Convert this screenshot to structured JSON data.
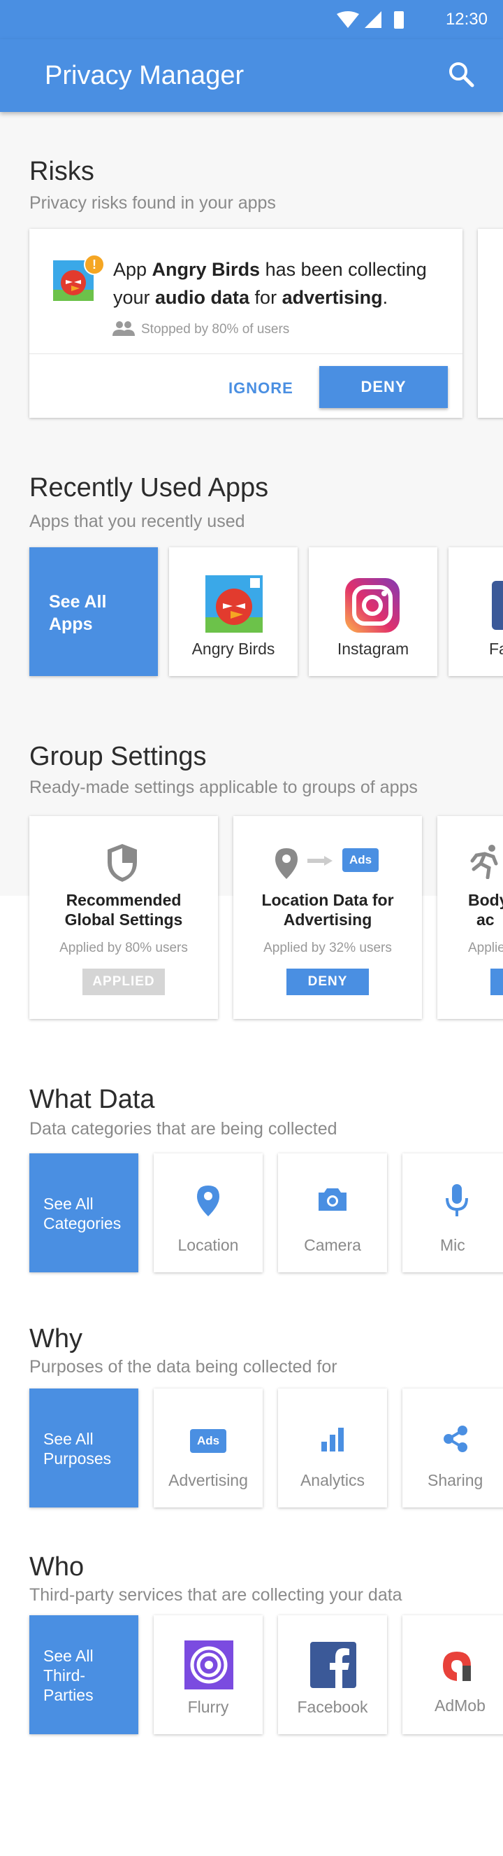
{
  "status_bar": {
    "time": "12:30"
  },
  "app_bar": {
    "title": "Privacy Manager"
  },
  "risks": {
    "title": "Risks",
    "subtitle": "Privacy risks found in your apps",
    "card": {
      "prefix": "App ",
      "app_name": "Angry Birds",
      "middle1": " has been collecting",
      "line2_prefix": "your ",
      "data_type": "audio data",
      "middle2": " for ",
      "purpose": "advertising",
      "suffix": ".",
      "stopped_text": "Stopped by 80% of users",
      "ignore_label": "IGNORE",
      "deny_label": "DENY",
      "warning_badge": "!"
    }
  },
  "recent_apps": {
    "title": "Recently Used Apps",
    "subtitle": "Apps that you recently used",
    "see_all": "See All Apps",
    "see_all_line1": "See All",
    "see_all_line2": "Apps",
    "apps": [
      {
        "label": "Angry Birds",
        "icon": "angry-birds-icon"
      },
      {
        "label": "Instagram",
        "icon": "instagram-icon"
      },
      {
        "label": "Fac",
        "icon": "facebook-icon"
      }
    ]
  },
  "group_settings": {
    "title": "Group Settings",
    "subtitle": "Ready-made settings applicable to groups of apps",
    "cards": [
      {
        "title_line1": "Recommended",
        "title_line2": "Global Settings",
        "applied": "Applied by 80% users",
        "button": "APPLIED",
        "icon": "shield-icon"
      },
      {
        "title_line1": "Location Data for",
        "title_line2": "Advertising",
        "applied": "Applied by 32% users",
        "button": "DENY",
        "icon": "location-to-ads-icon",
        "ads_badge": "Ads"
      },
      {
        "title_line1": "Body",
        "title_line2": "ac",
        "applied": "Applie",
        "button": "",
        "icon": "running-icon"
      }
    ]
  },
  "what_data": {
    "title": "What Data",
    "subtitle": "Data categories that are being collected",
    "see_all_line1": "See All",
    "see_all_line2": "Categories",
    "items": [
      {
        "label": "Location",
        "icon": "location-pin-icon"
      },
      {
        "label": "Camera",
        "icon": "camera-icon"
      },
      {
        "label": "Mic",
        "icon": "microphone-icon"
      }
    ]
  },
  "why": {
    "title": "Why",
    "subtitle": "Purposes of the data being collected for",
    "see_all_line1": "See All",
    "see_all_line2": "Purposes",
    "items": [
      {
        "label": "Advertising",
        "icon": "ads-icon",
        "badge": "Ads"
      },
      {
        "label": "Analytics",
        "icon": "bar-chart-icon"
      },
      {
        "label": "Sharing",
        "icon": "share-icon"
      }
    ]
  },
  "who": {
    "title": "Who",
    "subtitle": "Third-party services that are collecting your data",
    "see_all_line1": "See All",
    "see_all_line2": "Third-",
    "see_all_line3": "Parties",
    "items": [
      {
        "label": "Flurry",
        "icon": "flurry-icon"
      },
      {
        "label": "Facebook",
        "icon": "facebook-logo-icon"
      },
      {
        "label": "AdMob",
        "icon": "admob-icon"
      }
    ]
  },
  "colors": {
    "primary": "#4a8fe2",
    "background": "#f7f7f7",
    "warning": "#f5a623"
  }
}
